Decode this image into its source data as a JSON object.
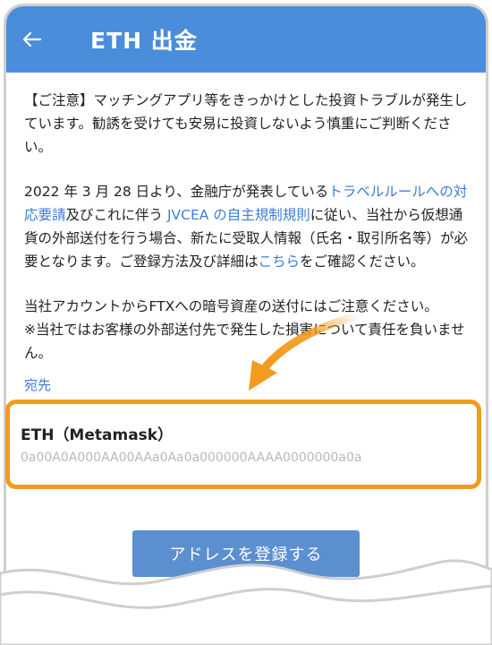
{
  "header": {
    "title": "ETH 出金",
    "back_icon": "back-arrow-icon"
  },
  "notice": {
    "caution": "【ご注意】マッチングアプリ等をきっかけとした投資トラブルが発生しています。勧誘を受けても安易に投資しないよう慎重にご判断ください。",
    "travel_rule_prefix": "2022 年 3 月 28 日より、金融庁が発表している",
    "travel_rule_link": "トラベルルールへの対応要請",
    "travel_rule_mid": "及びこれに伴う ",
    "jvcea_link": "JVCEA の自主規制規則",
    "travel_rule_suffix": "に従い、当社から仮想通貨の外部送付を行う場合、新たに受取人情報（氏名・取引所名等）が必要となります。ご登録方法及び詳細は",
    "here_link": "こちら",
    "travel_rule_end": "をご確認ください。",
    "ftx_warning": "当社アカウントからFTXへの暗号資産の送付にはご注意ください。",
    "liability": "※当社ではお客様の外部送付先で発生した損害について責任を負いません。"
  },
  "destination": {
    "label": "宛先",
    "name": "ETH（Metamask）",
    "address": "0a00A0A000AA00AAa0Aa0a000000AAAA0000000a0a"
  },
  "actions": {
    "register_label": "アドレスを登録する"
  },
  "colors": {
    "header": "#4a8edb",
    "highlight": "#f29b1d",
    "link": "#3b7ed4",
    "button": "#5b8fd0"
  }
}
